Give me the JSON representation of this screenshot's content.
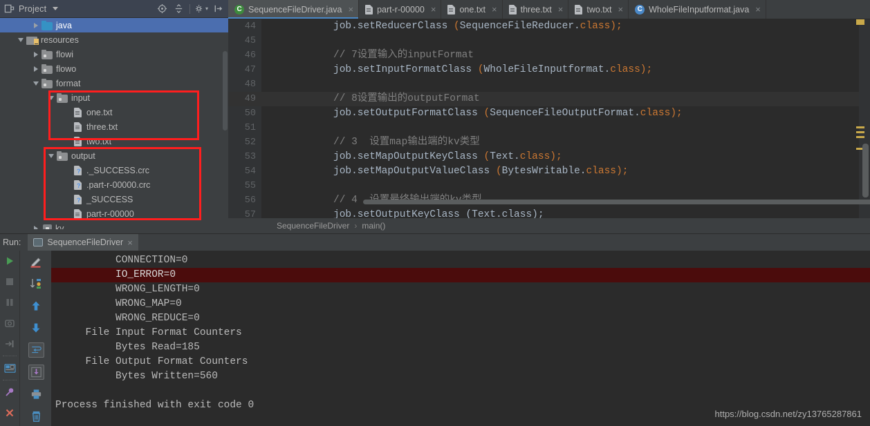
{
  "project_panel": {
    "title": "Project",
    "icons": [
      "project-view-icon",
      "chevron-down-icon",
      "locate-icon",
      "collapse-all-icon",
      "settings-icon",
      "hide-icon"
    ],
    "tree": [
      {
        "label": "java",
        "indent": 2,
        "arrow": "right",
        "icon": "folder-blue",
        "selected": true
      },
      {
        "label": "resources",
        "indent": 1,
        "arrow": "down",
        "icon": "folder-resources",
        "selected": false
      },
      {
        "label": "flowi",
        "indent": 2,
        "arrow": "right",
        "icon": "folder-grey",
        "selected": false
      },
      {
        "label": "flowo",
        "indent": 2,
        "arrow": "right",
        "icon": "folder-grey",
        "selected": false
      },
      {
        "label": "format",
        "indent": 2,
        "arrow": "down",
        "icon": "folder-grey",
        "selected": false
      },
      {
        "label": "input",
        "indent": 3,
        "arrow": "down",
        "icon": "folder-grey",
        "selected": false
      },
      {
        "label": "one.txt",
        "indent": 4,
        "arrow": "none",
        "icon": "file-text",
        "selected": false
      },
      {
        "label": "three.txt",
        "indent": 4,
        "arrow": "none",
        "icon": "file-text",
        "selected": false
      },
      {
        "label": "two.txt",
        "indent": 4,
        "arrow": "none",
        "icon": "file-text",
        "selected": false
      },
      {
        "label": "output",
        "indent": 3,
        "arrow": "down",
        "icon": "folder-grey",
        "selected": false
      },
      {
        "label": "._SUCCESS.crc",
        "indent": 4,
        "arrow": "none",
        "icon": "file-unknown",
        "selected": false
      },
      {
        "label": ".part-r-00000.crc",
        "indent": 4,
        "arrow": "none",
        "icon": "file-unknown",
        "selected": false
      },
      {
        "label": "_SUCCESS",
        "indent": 4,
        "arrow": "none",
        "icon": "file-unknown",
        "selected": false
      },
      {
        "label": "part-r-00000",
        "indent": 4,
        "arrow": "none",
        "icon": "file-text",
        "selected": false
      },
      {
        "label": "kv",
        "indent": 2,
        "arrow": "right",
        "icon": "module",
        "selected": false
      }
    ],
    "annotation_color": "#ff1e1e"
  },
  "tabs": [
    {
      "label": "SequenceFileDriver.java",
      "icon": "java-class-icon",
      "icon_color": "#3d8b3d",
      "active": true,
      "close": "×"
    },
    {
      "label": "part-r-00000",
      "icon": "file-icon",
      "active": false,
      "close": "×"
    },
    {
      "label": "one.txt",
      "icon": "file-icon",
      "active": false,
      "close": "×"
    },
    {
      "label": "three.txt",
      "icon": "file-icon",
      "active": false,
      "close": "×"
    },
    {
      "label": "two.txt",
      "icon": "file-icon",
      "active": false,
      "close": "×"
    },
    {
      "label": "WholeFileInputformat.java",
      "icon": "java-class-icon",
      "icon_color": "#4a88c7",
      "active": false,
      "close": "×"
    }
  ],
  "editor": {
    "lines": [
      {
        "n": "44",
        "segments": [
          {
            "t": "job.setReducerClass ",
            "c": "t-def"
          },
          {
            "t": "(",
            "c": "t-par"
          },
          {
            "t": "SequenceFileReducer.",
            "c": "t-cls"
          },
          {
            "t": "class",
            "c": "t-kw"
          },
          {
            "t": ");",
            "c": "t-par"
          }
        ],
        "hl": false
      },
      {
        "n": "45",
        "segments": [],
        "hl": false
      },
      {
        "n": "46",
        "segments": [
          {
            "t": "// 7设置输入的inputFormat",
            "c": "t-com"
          }
        ],
        "hl": false
      },
      {
        "n": "47",
        "segments": [
          {
            "t": "job.setInputFormatClass ",
            "c": "t-def"
          },
          {
            "t": "(",
            "c": "t-par"
          },
          {
            "t": "WholeFileInputformat.",
            "c": "t-cls"
          },
          {
            "t": "class",
            "c": "t-kw"
          },
          {
            "t": ");",
            "c": "t-par"
          }
        ],
        "hl": false
      },
      {
        "n": "48",
        "segments": [],
        "hl": false
      },
      {
        "n": "49",
        "segments": [
          {
            "t": "// 8设置输出的outputFormat",
            "c": "t-com"
          }
        ],
        "hl": true
      },
      {
        "n": "50",
        "segments": [
          {
            "t": "job.setOutputFormatClass ",
            "c": "t-def"
          },
          {
            "t": "(",
            "c": "t-par"
          },
          {
            "t": "SequenceFileOutputFormat.",
            "c": "t-cls"
          },
          {
            "t": "class",
            "c": "t-kw"
          },
          {
            "t": ");",
            "c": "t-par"
          }
        ],
        "hl": false
      },
      {
        "n": "51",
        "segments": [],
        "hl": false
      },
      {
        "n": "52",
        "segments": [
          {
            "t": "// 3  设置map输出端的kv类型",
            "c": "t-com"
          }
        ],
        "hl": false
      },
      {
        "n": "53",
        "segments": [
          {
            "t": "job.setMapOutputKeyClass ",
            "c": "t-def"
          },
          {
            "t": "(",
            "c": "t-par"
          },
          {
            "t": "Text.",
            "c": "t-cls"
          },
          {
            "t": "class",
            "c": "t-kw"
          },
          {
            "t": ");",
            "c": "t-par"
          }
        ],
        "hl": false
      },
      {
        "n": "54",
        "segments": [
          {
            "t": "job.setMapOutputValueClass ",
            "c": "t-def"
          },
          {
            "t": "(",
            "c": "t-par"
          },
          {
            "t": "BytesWritable.",
            "c": "t-cls"
          },
          {
            "t": "class",
            "c": "t-kw"
          },
          {
            "t": ");",
            "c": "t-par"
          }
        ],
        "hl": false
      },
      {
        "n": "55",
        "segments": [],
        "hl": false
      },
      {
        "n": "56",
        "segments": [
          {
            "t": "// 4  设置最终输出端的kv类型",
            "c": "t-com"
          }
        ],
        "hl": false
      },
      {
        "n": "57",
        "segments": [
          {
            "t": "job.setOutputKeyClass (Text.class);",
            "c": "t-def"
          }
        ],
        "hl": false
      }
    ],
    "breadcrumb": [
      "SequenceFileDriver",
      "main()"
    ],
    "breadcrumb_sep": "›"
  },
  "run_panel": {
    "label": "Run:",
    "tab_label": "SequenceFileDriver",
    "tab_close": "×",
    "left_tools": [
      "rerun-icon",
      "stop-icon",
      "pause-icon",
      "dump-threads-icon",
      "restore-layout-icon",
      "settings-icon",
      "pin-icon",
      "close-icon"
    ],
    "right_tools": [
      "edit-config-icon",
      "scroll-to-end-icon",
      "up-arrow-icon",
      "down-arrow-icon",
      "soft-wrap-icon",
      "scroll-to-end-2-icon",
      "print-icon",
      "clear-all-icon"
    ],
    "console": [
      {
        "text": "          CONNECTION=0",
        "error": false
      },
      {
        "text": "          IO_ERROR=0",
        "error": true
      },
      {
        "text": "          WRONG_LENGTH=0",
        "error": false
      },
      {
        "text": "          WRONG_MAP=0",
        "error": false
      },
      {
        "text": "          WRONG_REDUCE=0",
        "error": false
      },
      {
        "text": "     File Input Format Counters",
        "error": false
      },
      {
        "text": "          Bytes Read=185",
        "error": false
      },
      {
        "text": "     File Output Format Counters",
        "error": false
      },
      {
        "text": "          Bytes Written=560",
        "error": false
      },
      {
        "text": "",
        "error": false
      },
      {
        "text": "Process finished with exit code 0",
        "error": false
      }
    ]
  },
  "watermark": "https://blog.csdn.net/zy13765287861",
  "colors": {
    "accent_blue": "#4b6eaf",
    "annotation_red": "#ff1e1e",
    "console_error_bg": "#4b0c0c",
    "editor_bg": "#2b2b2b",
    "panel_bg": "#3c3f41"
  }
}
